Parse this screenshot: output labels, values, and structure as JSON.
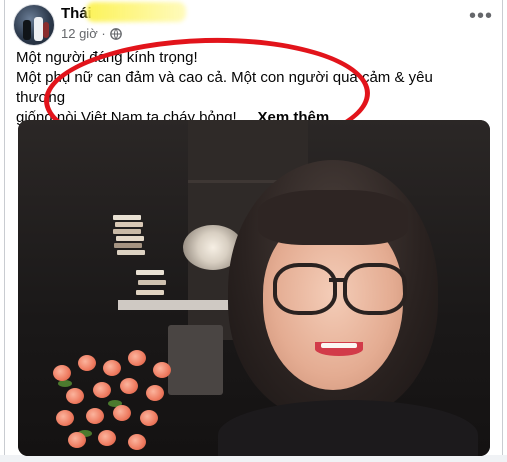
{
  "post": {
    "author": "Thái",
    "time": "12 giờ ·",
    "more_symbol": "•••",
    "text_line1": "Một người đáng kính trọng!",
    "text_line2": "Một phụ nữ can đảm và cao cả. Một con người quả cảm & yêu thương",
    "text_line3": "giống nòi Việt Nam ta cháy bỏng! ...",
    "see_more": "Xem thêm"
  },
  "icons": {
    "globe": "globe-icon",
    "more": "more-options-icon"
  },
  "colors": {
    "annotation_ellipse": "#e2141b",
    "name_highlight": "#fcf250",
    "text": "#050505",
    "meta": "#65676b"
  }
}
